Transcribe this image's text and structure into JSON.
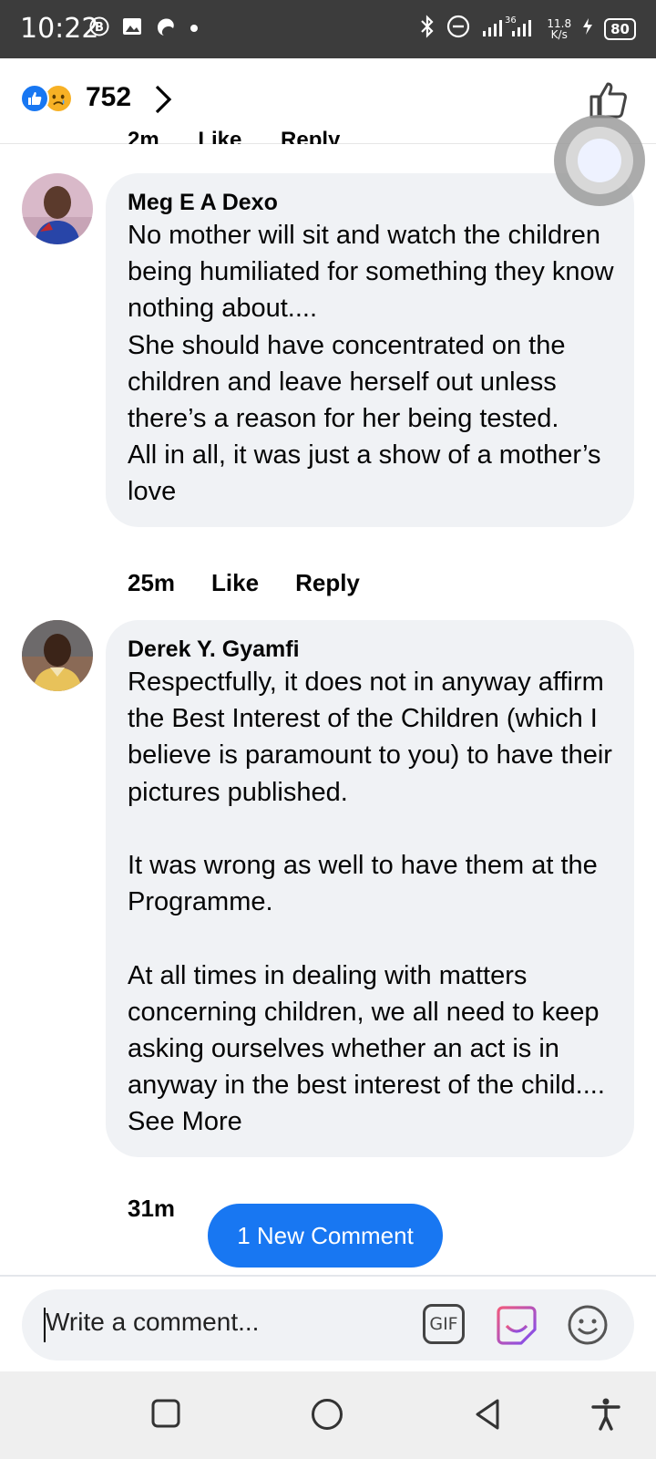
{
  "status_bar": {
    "time": "10:22",
    "network_speed_value": "11.8",
    "network_speed_unit": "K/s",
    "signal_label": "36",
    "battery": "80"
  },
  "header": {
    "reaction_count": "752",
    "clipped_meta": "2m Like Reply"
  },
  "comments": [
    {
      "author": "Meg E A Dexo",
      "text": "No mother will sit and watch the children being humiliated for something they know nothing about....\nShe should have concentrated on the children and leave herself out unless there’s a reason for her being tested.\nAll in all, it was just a show of a mother’s love",
      "time": "25m",
      "like_label": "Like",
      "reply_label": "Reply"
    },
    {
      "author": "Derek Y. Gyamfi",
      "text": "Respectfully, it does not in anyway affirm the Best Interest of the Children (which I believe is paramount to you) to have their pictures published.\n\nIt was wrong as well to have them at the Programme.\n\nAt all times in dealing with matters concerning children, we all need to keep asking ourselves whether an act is in anyway in the best interest of the child....",
      "see_more": "See More",
      "time": "31m"
    }
  ],
  "new_comment_button": "1 New Comment",
  "composer": {
    "placeholder": "Write a comment...",
    "gif_label": "GIF"
  },
  "colors": {
    "accent": "#1877f2",
    "bubble_bg": "#f0f2f5",
    "status_bar_bg": "#3c3c3c"
  },
  "icons": [
    "bluetooth-icon",
    "do-not-disturb-icon",
    "signal-icon",
    "battery-icon",
    "like-icon",
    "sad-reaction-icon",
    "chevron-right-icon",
    "thumbs-up-icon",
    "gif-icon",
    "sticker-icon",
    "emoji-icon",
    "recents-icon",
    "home-icon",
    "back-icon",
    "accessibility-icon"
  ]
}
